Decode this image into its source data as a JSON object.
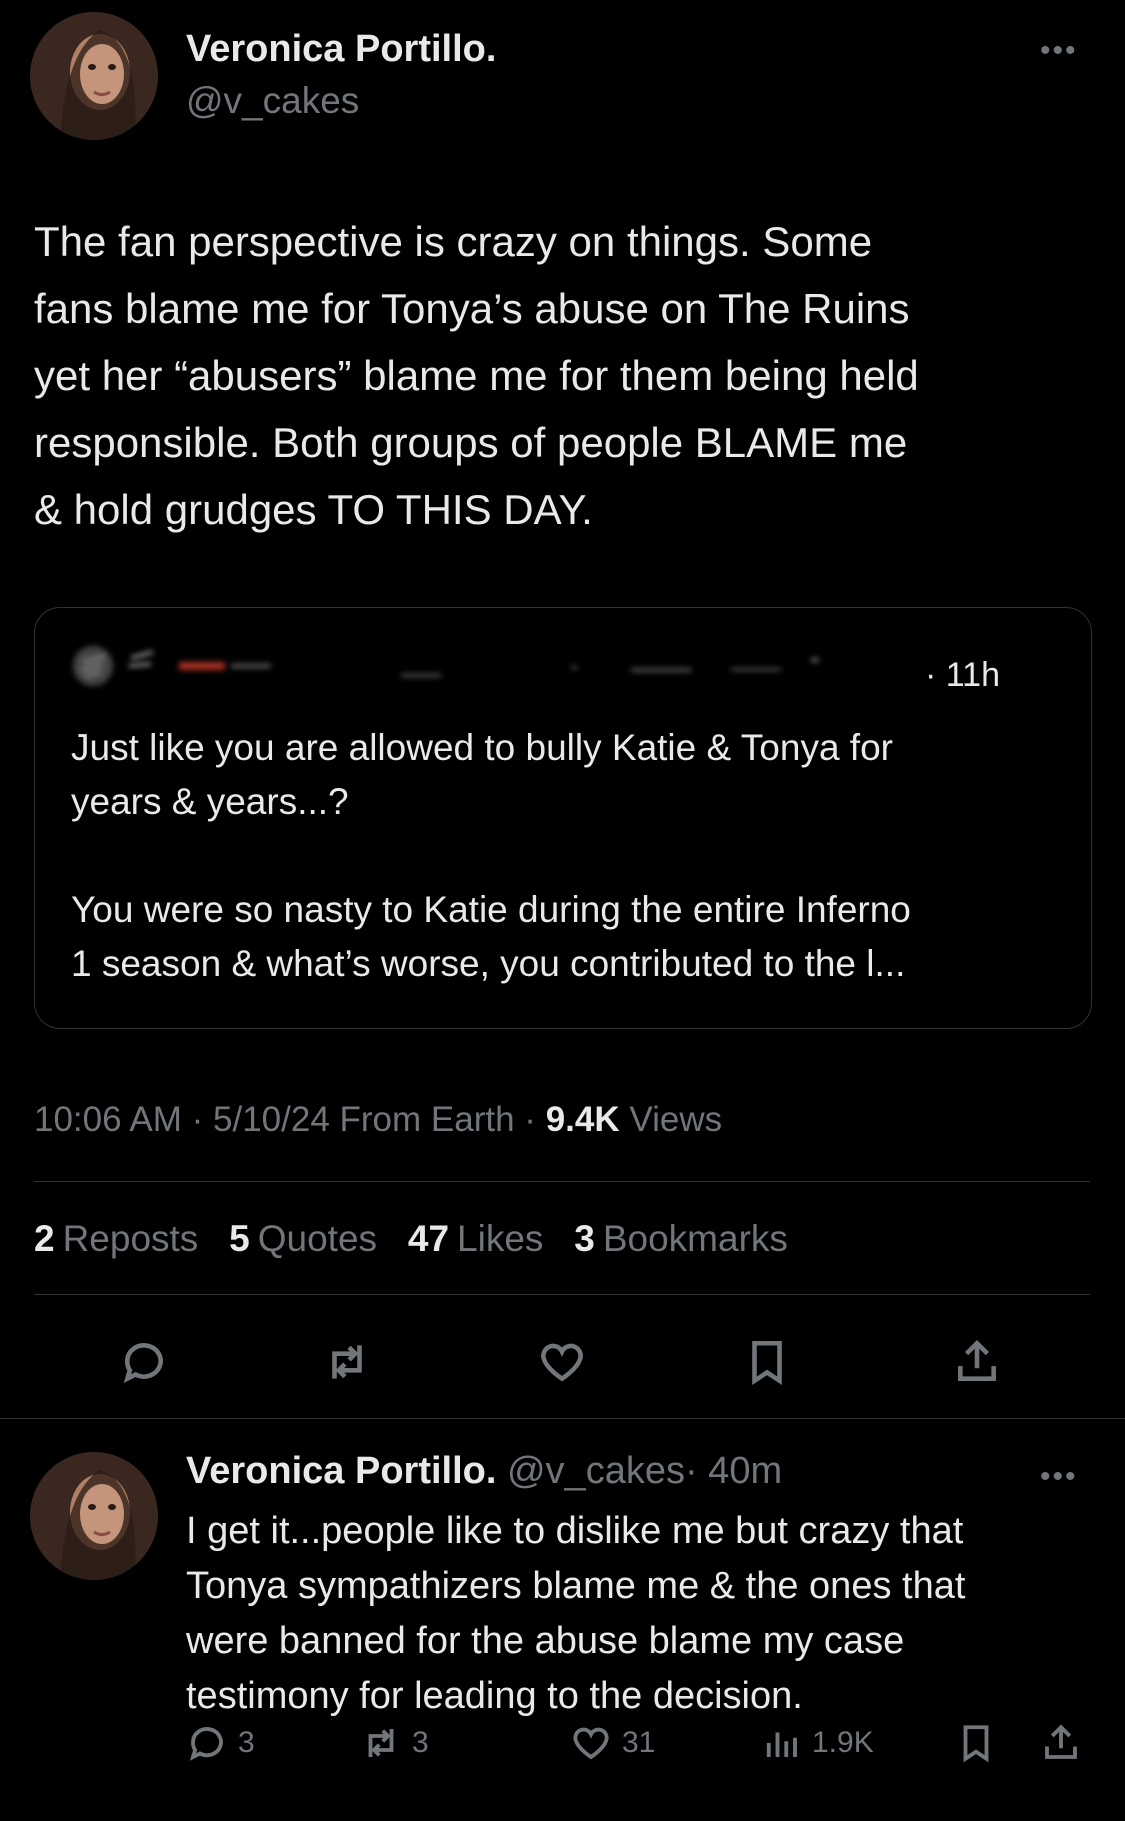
{
  "tweet": {
    "author_name": "Veronica Portillo.",
    "author_handle": "@v_cakes",
    "more_label": "•••",
    "text_lines": [
      "The fan perspective is crazy on things. Some",
      "fans blame me for Tonya’s abuse on The Ruins",
      "yet her “abusers” blame me for them being held",
      "responsible.  Both groups of people BLAME me",
      "& hold grudges TO THIS DAY."
    ],
    "quote": {
      "time": "· 11h",
      "lines": [
        "Just like you are allowed to bully Katie & Tonya for",
        "years & years...?",
        "",
        "You were so nasty to Katie during the entire Inferno",
        "1 season & what’s worse, you contributed to the l..."
      ]
    },
    "meta": {
      "time": "10:06 AM",
      "sep1": "·",
      "date": "5/10/24 From Earth",
      "sep2": "·",
      "views_count": "9.4K",
      "views_label": "Views"
    },
    "stats": {
      "reposts_count": "2",
      "reposts_label": "Reposts",
      "quotes_count": "5",
      "quotes_label": "Quotes",
      "likes_count": "47",
      "likes_label": "Likes",
      "bookmarks_count": "3",
      "bookmarks_label": "Bookmarks"
    },
    "actions": [
      "reply-icon",
      "repost-icon",
      "like-icon",
      "bookmark-icon",
      "share-icon"
    ]
  },
  "reply": {
    "author_name": "Veronica Portillo.",
    "author_handle": "@v_cakes",
    "time": "· 40m",
    "more_label": "•••",
    "text_lines": [
      "I get it...people like to dislike me but crazy that",
      "Tonya sympathizers  blame me & the ones that",
      "were banned for the abuse blame my case",
      "testimony for leading to the decision."
    ],
    "actions": {
      "replies": "3",
      "reposts": "3",
      "likes": "31",
      "views": "1.9K"
    }
  },
  "colors": {
    "background": "#000000",
    "text": "#e7e9ea",
    "muted": "#71767b",
    "border": "#2f3336"
  }
}
